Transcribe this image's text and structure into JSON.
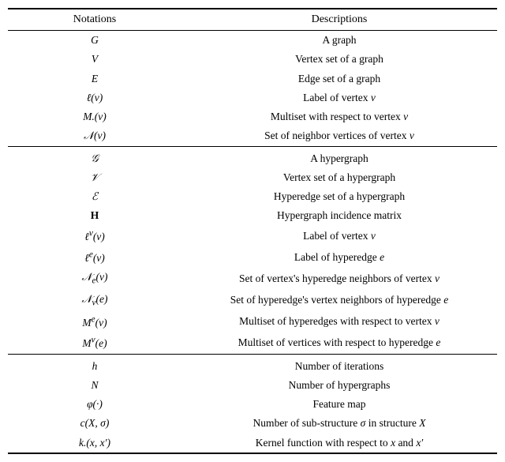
{
  "table": {
    "header": {
      "col1": "Notations",
      "col2": "Descriptions"
    },
    "section1": [
      {
        "notation": "G",
        "italic": true,
        "description": "A graph"
      },
      {
        "notation": "V",
        "italic": true,
        "description": "Vertex set of a graph"
      },
      {
        "notation": "E",
        "italic": true,
        "description": "Edge set of a graph"
      },
      {
        "notation": "ℓ(v)",
        "italic": true,
        "description": "Label of vertex v"
      },
      {
        "notation": "M.(v)",
        "italic": true,
        "description": "Multiset with respect to vertex v"
      },
      {
        "notation": "𝒩(v)",
        "italic": true,
        "description": "Set of neighbor vertices of vertex v"
      }
    ],
    "section2": [
      {
        "notation": "𝒢",
        "italic": true,
        "description": "A hypergraph"
      },
      {
        "notation": "𝒱",
        "italic": true,
        "description": "Vertex set of a hypergraph"
      },
      {
        "notation": "ℰ",
        "italic": true,
        "description": "Hyperedge set of a hypergraph"
      },
      {
        "notation": "H",
        "bold": true,
        "description": "Hypergraph incidence matrix"
      },
      {
        "notation": "ℓᵥ(v)",
        "italic": true,
        "description": "Label of vertex v"
      },
      {
        "notation": "ℓᵒ(v)",
        "italic": true,
        "description": "Label of hyperedge e"
      },
      {
        "notation": "𝒩ₑ(v)",
        "italic": true,
        "description": "Set of vertex's hyperedge neighbors of vertex v"
      },
      {
        "notation": "𝒩ᵥ(e)",
        "italic": true,
        "description": "Set of hyperedge's vertex neighbors of hyperedge e"
      },
      {
        "notation": "Mᵒ(v)",
        "italic": true,
        "description": "Multiset of hyperedges with respect to vertex v"
      },
      {
        "notation": "Mᵥ(e)",
        "italic": true,
        "description": "Multiset of vertices with respect to hyperedge e"
      }
    ],
    "section3": [
      {
        "notation": "h",
        "italic": true,
        "description": "Number of iterations"
      },
      {
        "notation": "N",
        "italic": true,
        "description": "Number of hypergraphs"
      },
      {
        "notation": "φ(·)",
        "italic": true,
        "description": "Feature map"
      },
      {
        "notation": "c(X, σ)",
        "italic": true,
        "description": "Number of sub-structure σ in structure X"
      },
      {
        "notation": "k.(x, x′)",
        "italic": true,
        "description": "Kernel function with respect to x and x′"
      }
    ]
  }
}
